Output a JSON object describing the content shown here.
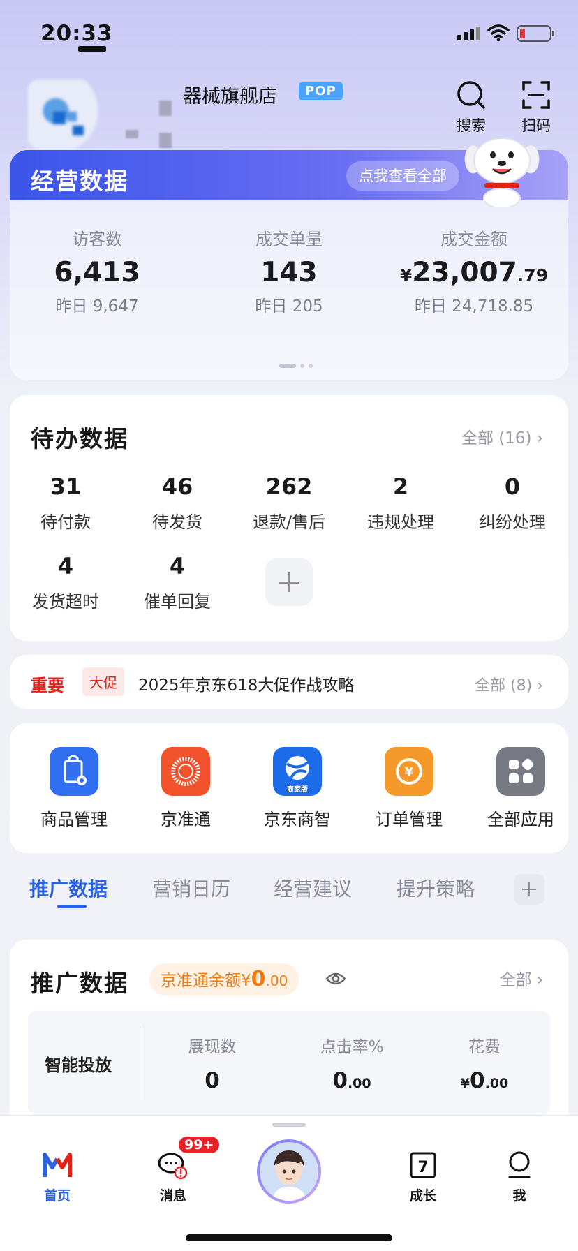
{
  "status_bar": {
    "time": "20:33"
  },
  "header": {
    "shop_name": "器械旗舰店",
    "badge": "POP",
    "search_label": "搜索",
    "scan_label": "扫码"
  },
  "business": {
    "title": "经营数据",
    "view_all": "点我查看全部",
    "metrics": [
      {
        "label": "访客数",
        "value": "6,413",
        "yesterday": "昨日 9,647"
      },
      {
        "label": "成交单量",
        "value": "143",
        "yesterday": "昨日 205"
      },
      {
        "label": "成交金额",
        "currency": "¥",
        "value": "23,007",
        "decimals": ".79",
        "yesterday": "昨日 24,718.85"
      }
    ]
  },
  "todo": {
    "title": "待办数据",
    "all": "全部 (16)",
    "items": [
      {
        "num": "31",
        "label": "待付款"
      },
      {
        "num": "46",
        "label": "待发货"
      },
      {
        "num": "262",
        "label": "退款/售后"
      },
      {
        "num": "2",
        "label": "违规处理"
      },
      {
        "num": "0",
        "label": "纠纷处理"
      },
      {
        "num": "4",
        "label": "发货超时"
      },
      {
        "num": "4",
        "label": "催单回复"
      }
    ]
  },
  "notice": {
    "important": "重要",
    "tag": "大促",
    "text": "2025年京东618大促作战攻略",
    "all": "全部 (8)"
  },
  "apps": [
    {
      "label": "商品管理",
      "icon": "product-manage-icon",
      "color": "#2f6ff0"
    },
    {
      "label": "京准通",
      "icon": "jingzhuntong-icon",
      "color": "#f2532c"
    },
    {
      "label": "京东商智",
      "icon": "jd-shangzhi-icon",
      "color": "#1c6be8",
      "sublabel": "商家版"
    },
    {
      "label": "订单管理",
      "icon": "order-manage-icon",
      "color": "#f59a2a"
    },
    {
      "label": "全部应用",
      "icon": "all-apps-icon",
      "color": "#777a83"
    }
  ],
  "tabs": [
    {
      "label": "推广数据",
      "active": true
    },
    {
      "label": "营销日历"
    },
    {
      "label": "经营建议"
    },
    {
      "label": "提升策略"
    }
  ],
  "promo": {
    "title": "推广数据",
    "balance_label": "京准通余额",
    "balance_currency": "¥",
    "balance_int": "0",
    "balance_dec": ".00",
    "all": "全部",
    "row_head": "智能投放",
    "cols": [
      {
        "head": "展现数",
        "value": "0"
      },
      {
        "head": "点击率%",
        "value": "0",
        "dec": ".00"
      },
      {
        "head": "花费",
        "currency": "¥",
        "value": "0",
        "dec": ".00"
      }
    ]
  },
  "bottom_nav": {
    "home": "首页",
    "messages": "消息",
    "messages_badge": "99+",
    "growth": "成长",
    "growth_day": "7",
    "me": "我"
  },
  "colors": {
    "accent": "#2b63e0",
    "danger": "#e2231a",
    "orange": "#f07a10"
  }
}
